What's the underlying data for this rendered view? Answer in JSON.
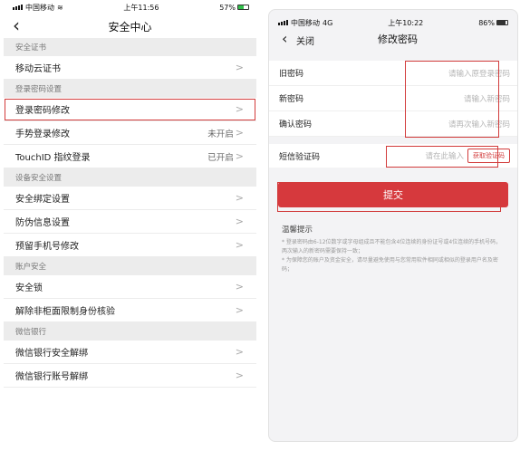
{
  "left": {
    "status": {
      "carrier": "中国移动",
      "time": "上午11:56",
      "battery": "57%",
      "battery_level": 0.57
    },
    "nav": {
      "back_icon": "chevron-left-icon",
      "title": "安全中心"
    },
    "groups": [
      {
        "header": "安全证书",
        "items": [
          {
            "label": "移动云证书",
            "value": ""
          }
        ]
      },
      {
        "header": "登录密码设置",
        "items": [
          {
            "label": "登录密码修改",
            "value": "",
            "highlight": true
          },
          {
            "label": "手势登录修改",
            "value": "未开启"
          },
          {
            "label": "TouchID 指纹登录",
            "value": "已开启"
          }
        ]
      },
      {
        "header": "设备安全设置",
        "items": [
          {
            "label": "安全绑定设置",
            "value": ""
          },
          {
            "label": "防伪信息设置",
            "value": ""
          },
          {
            "label": "预留手机号修改",
            "value": ""
          }
        ]
      },
      {
        "header": "账户安全",
        "items": [
          {
            "label": "安全锁",
            "value": ""
          },
          {
            "label": "解除非柜面限制身份核验",
            "value": ""
          }
        ]
      },
      {
        "header": "微信银行",
        "items": [
          {
            "label": "微信银行安全解绑",
            "value": ""
          },
          {
            "label": "微信银行账号解绑",
            "value": ""
          }
        ]
      }
    ],
    "chevron": ">"
  },
  "right": {
    "status": {
      "carrier": "中国移动",
      "network": "4G",
      "time": "上午10:22",
      "battery": "86%",
      "battery_level": 0.86
    },
    "nav": {
      "back_label": "关闭",
      "title": "修改密码"
    },
    "fields": [
      {
        "label": "旧密码",
        "placeholder": "请输入原登录密码"
      },
      {
        "label": "新密码",
        "placeholder": "请输入新密码"
      },
      {
        "label": "确认密码",
        "placeholder": "请再次输入新密码"
      }
    ],
    "sms": {
      "label": "短信验证码",
      "placeholder": "请在此输入",
      "button": "获取验证码"
    },
    "submit": "提交",
    "tips": {
      "title": "温馨提示",
      "lines": [
        "* 登录密码由6-12位数字或字母组成且不能包含4位连续的身份证号或4位连续的手机号码，两次输入的新密码需要保持一致；",
        "* 为保障您的账户及资金安全，请尽量避免使用与您常用软件相同或相似的登录用户名及密码；"
      ]
    },
    "accent_color": "#d6393d"
  }
}
